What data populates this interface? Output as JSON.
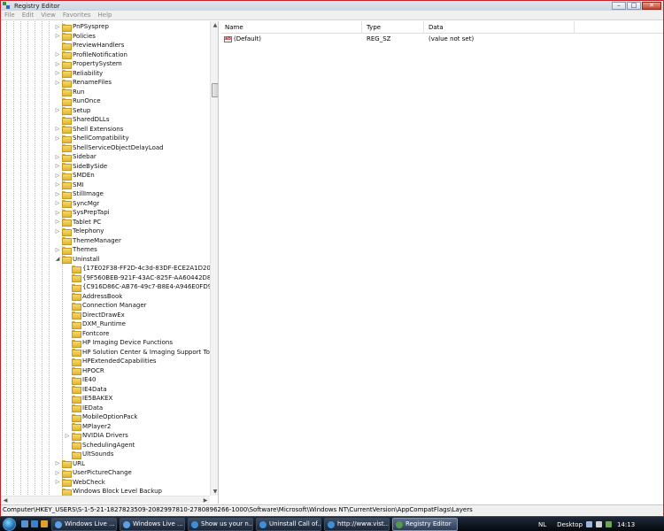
{
  "window": {
    "title": "Registry Editor"
  },
  "menu": [
    "File",
    "Edit",
    "View",
    "Favorites",
    "Help"
  ],
  "window_buttons": {
    "minimize": "–",
    "maximize": "□",
    "close": "✕"
  },
  "tree": {
    "items": [
      {
        "label": "PnPSysprep",
        "expander": "▷"
      },
      {
        "label": "Policies",
        "expander": "▷"
      },
      {
        "label": "PreviewHandlers",
        "expander": ""
      },
      {
        "label": "ProfileNotification",
        "expander": "▷"
      },
      {
        "label": "PropertySystem",
        "expander": "▷"
      },
      {
        "label": "Reliability",
        "expander": "▷"
      },
      {
        "label": "RenameFiles",
        "expander": "▷"
      },
      {
        "label": "Run",
        "expander": ""
      },
      {
        "label": "RunOnce",
        "expander": ""
      },
      {
        "label": "Setup",
        "expander": "▷"
      },
      {
        "label": "SharedDLLs",
        "expander": ""
      },
      {
        "label": "Shell Extensions",
        "expander": "▷"
      },
      {
        "label": "ShellCompatibility",
        "expander": "▷"
      },
      {
        "label": "ShellServiceObjectDelayLoad",
        "expander": ""
      },
      {
        "label": "Sidebar",
        "expander": "▷"
      },
      {
        "label": "SideBySide",
        "expander": "▷"
      },
      {
        "label": "SMDEn",
        "expander": "▷"
      },
      {
        "label": "SMI",
        "expander": "▷"
      },
      {
        "label": "StillImage",
        "expander": "▷"
      },
      {
        "label": "SyncMgr",
        "expander": "▷"
      },
      {
        "label": "SysPrepTapi",
        "expander": "▷"
      },
      {
        "label": "Tablet PC",
        "expander": "▷"
      },
      {
        "label": "Telephony",
        "expander": "▷"
      },
      {
        "label": "ThemeManager",
        "expander": ""
      },
      {
        "label": "Themes",
        "expander": "▷"
      },
      {
        "label": "Uninstall",
        "expander": "◢"
      },
      {
        "label": "{17E02F38-FF2D-4c3d-83DF-ECE2A1D20A5E}",
        "expander": ""
      },
      {
        "label": "{9F560BEB-921F-43AC-825F-AA60442D8DE4}",
        "expander": ""
      },
      {
        "label": "{C916D86C-AB76-49c7-B8E4-A946E0FD9BC2}",
        "expander": ""
      },
      {
        "label": "AddressBook",
        "expander": ""
      },
      {
        "label": "Connection Manager",
        "expander": ""
      },
      {
        "label": "DirectDrawEx",
        "expander": ""
      },
      {
        "label": "DXM_Runtime",
        "expander": ""
      },
      {
        "label": "Fontcore",
        "expander": ""
      },
      {
        "label": "HP Imaging Device Functions",
        "expander": ""
      },
      {
        "label": "HP Solution Center & Imaging Support Tools",
        "expander": ""
      },
      {
        "label": "HPExtendedCapabilities",
        "expander": ""
      },
      {
        "label": "HPOCR",
        "expander": ""
      },
      {
        "label": "IE40",
        "expander": ""
      },
      {
        "label": "IE4Data",
        "expander": ""
      },
      {
        "label": "IE5BAKEX",
        "expander": ""
      },
      {
        "label": "IEData",
        "expander": ""
      },
      {
        "label": "MobileOptionPack",
        "expander": ""
      },
      {
        "label": "MPlayer2",
        "expander": ""
      },
      {
        "label": "NVIDIA Drivers",
        "expander": "▷"
      },
      {
        "label": "SchedulingAgent",
        "expander": ""
      },
      {
        "label": "UltSounds",
        "expander": ""
      },
      {
        "label": "URL",
        "expander": "▷"
      },
      {
        "label": "UserPictureChange",
        "expander": "▷"
      },
      {
        "label": "WebCheck",
        "expander": "▷"
      },
      {
        "label": "Windows Block Level Backup",
        "expander": ""
      }
    ]
  },
  "list": {
    "columns": [
      "Name",
      "Type",
      "Data"
    ],
    "rows": [
      {
        "name": "(Default)",
        "type": "REG_SZ",
        "data": "(value not set)",
        "icon": "ab"
      }
    ]
  },
  "scrollbar": {
    "up": "▲",
    "down": "▼",
    "left": "◀",
    "right": "▶"
  },
  "status_path": "Computer\\HKEY_USERS\\S-1-5-21-1827823509-2082997810-2780896266-1000\\Software\\Microsoft\\Windows NT\\CurrentVersion\\AppCompatFlags\\Layers",
  "taskbar": {
    "tasks": [
      {
        "label": "Windows Live ...",
        "active": false,
        "icon_color": "#5aa0e8"
      },
      {
        "label": "Windows Live ...",
        "active": false,
        "icon_color": "#5aa0e8"
      },
      {
        "label": "Show us your n...",
        "active": false,
        "icon_color": "#3d8fd8"
      },
      {
        "label": "Uninstall Call of...",
        "active": false,
        "icon_color": "#3d8fd8"
      },
      {
        "label": "http://www.vist...",
        "active": false,
        "icon_color": "#3d8fd8"
      },
      {
        "label": "Registry Editor",
        "active": true,
        "icon_color": "#4f9a4f"
      }
    ],
    "language": "NL",
    "desktop_label": "Desktop",
    "clock": "14:13"
  },
  "colors": {
    "accent_border": "#c8202a",
    "folder": "#e8bf3c"
  }
}
